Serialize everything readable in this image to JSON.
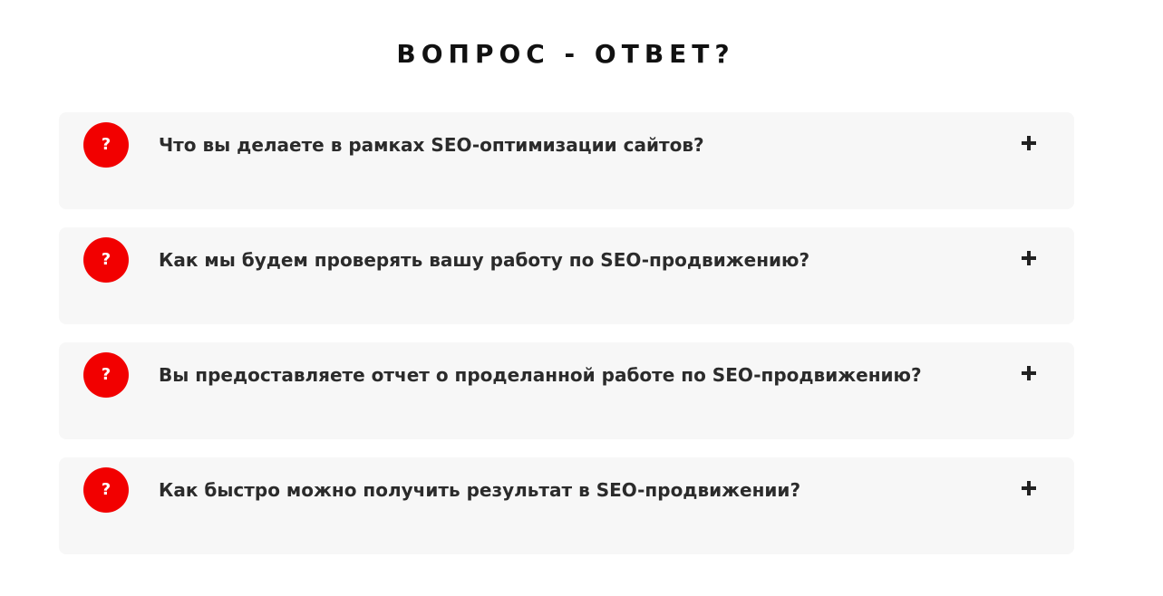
{
  "page": {
    "title": "ВОПРОС - ОТВЕТ?"
  },
  "faq": {
    "badge_symbol": "?",
    "badge_color": "#f20000",
    "item_background": "#f7f7f7",
    "toggle_icon": "plus-icon",
    "items": [
      {
        "question": "Что вы делаете в рамках SEO-оптимизации сайтов?"
      },
      {
        "question": "Как мы будем проверять вашу работу по SEO-продвижению?"
      },
      {
        "question": "Вы предоставляете отчет о проделанной работе по SEO-продвижению?"
      },
      {
        "question": "Как быстро можно получить результат в SEO-продвижении?"
      }
    ]
  }
}
